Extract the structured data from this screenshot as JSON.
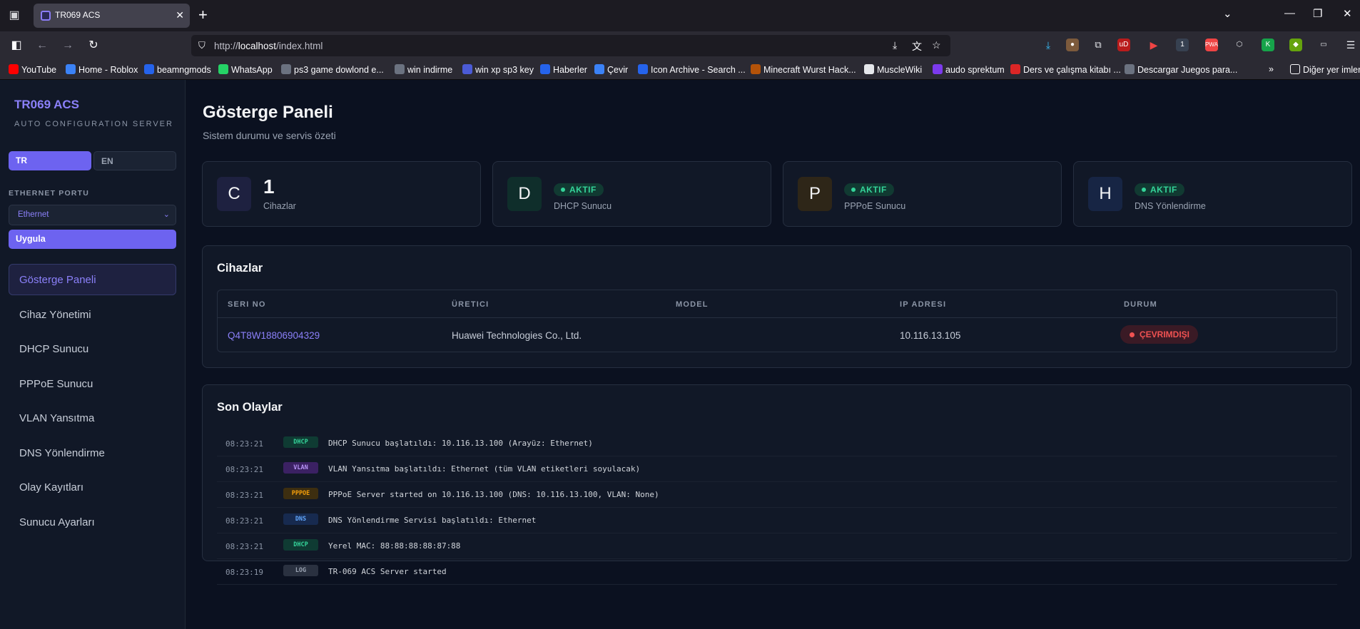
{
  "browser": {
    "tab_title": "TR069 ACS",
    "url_prefix": "http://",
    "url_host": "localhost",
    "url_path": "/index.html",
    "bookmarks": [
      {
        "label": "YouTube",
        "icon": "youtube-icon",
        "color": "#ff0000"
      },
      {
        "label": "Home - Roblox",
        "icon": "roblox-icon",
        "color": "#3b82f6"
      },
      {
        "label": "beamngmods",
        "icon": "beamng-icon",
        "color": "#2563eb"
      },
      {
        "label": "WhatsApp",
        "icon": "whatsapp-icon",
        "color": "#25d366"
      },
      {
        "label": "ps3 game dowlond e...",
        "icon": "globe-icon",
        "color": "#6b7280"
      },
      {
        "label": "win indirme",
        "icon": "globe-icon",
        "color": "#6b7280"
      },
      {
        "label": "win xp sp3 key",
        "icon": "wordpress-icon",
        "color": "#4b5bd6"
      },
      {
        "label": "Haberler",
        "icon": "news-icon",
        "color": "#2563eb"
      },
      {
        "label": "Çevir",
        "icon": "translate-icon",
        "color": "#3b82f6"
      },
      {
        "label": "Icon Archive - Search ...",
        "icon": "star-icon",
        "color": "#2563eb"
      },
      {
        "label": "Minecraft Wurst Hack...",
        "icon": "wurst-icon",
        "color": "#b45309"
      },
      {
        "label": "MuscleWiki",
        "icon": "musclewiki-icon",
        "color": "#e5e7eb"
      },
      {
        "label": "audo sprektum",
        "icon": "audio-icon",
        "color": "#7c3aed"
      },
      {
        "label": "Ders ve çalışma kitabı ...",
        "icon": "book-icon",
        "color": "#dc2626"
      },
      {
        "label": "Descargar Juegos para...",
        "icon": "globe-icon",
        "color": "#6b7280"
      }
    ],
    "other_bookmarks": "Diğer yer imler"
  },
  "sidebar": {
    "brand": "TR069 ACS",
    "brand_sub": "AUTO CONFIGURATION SERVER",
    "lang_tr": "TR",
    "lang_en": "EN",
    "port_label": "ETHERNET PORTU",
    "port_value": "Ethernet",
    "apply": "Uygula",
    "menu": [
      "Gösterge Paneli",
      "Cihaz Yönetimi",
      "DHCP Sunucu",
      "PPPoE Sunucu",
      "VLAN Yansıtma",
      "DNS Yönlendirme",
      "Olay Kayıtları",
      "Sunucu Ayarları"
    ],
    "active_index": 0
  },
  "main": {
    "title": "Gösterge Paneli",
    "subtitle": "Sistem durumu ve servis özeti",
    "stats": [
      {
        "letter": "C",
        "value": "1",
        "label": "Cihazlar",
        "color": "#1e2140"
      },
      {
        "letter": "D",
        "status": "AKTIF",
        "label": "DHCP Sunucu",
        "color": "#0f2e2b"
      },
      {
        "letter": "P",
        "status": "AKTIF",
        "label": "PPPoE Sunucu",
        "color": "#2e2618"
      },
      {
        "letter": "H",
        "status": "AKTIF",
        "label": "DNS Yönlendirme",
        "color": "#172544"
      }
    ],
    "devices": {
      "title": "Cihazlar",
      "columns": [
        "SERI NO",
        "ÜRETICI",
        "MODEL",
        "IP ADRESI",
        "DURUM"
      ],
      "rows": [
        {
          "serial": "Q4T8W18806904329",
          "vendor": "Huawei Technologies Co., Ltd.",
          "model": "",
          "ip": "10.116.13.105",
          "status": "ÇEVRIMDIŞI"
        }
      ]
    },
    "events": {
      "title": "Son Olaylar",
      "items": [
        {
          "time": "08:23:21",
          "tag": "DHCP",
          "tag_bg": "#0f3b33",
          "tag_fg": "#34d399",
          "message": "DHCP Sunucu başlatıldı: 10.116.13.100 (Arayüz: Ethernet)"
        },
        {
          "time": "08:23:21",
          "tag": "VLAN",
          "tag_bg": "#3b2163",
          "tag_fg": "#b794f6",
          "message": "VLAN Yansıtma başlatıldı: Ethernet (tüm VLAN etiketleri soyulacak)"
        },
        {
          "time": "08:23:21",
          "tag": "PPPOE",
          "tag_bg": "#3d2e10",
          "tag_fg": "#f59e0b",
          "message": "PPPoE Server started on 10.116.13.100 (DNS: 10.116.13.100, VLAN: None)"
        },
        {
          "time": "08:23:21",
          "tag": "DNS",
          "tag_bg": "#172a4f",
          "tag_fg": "#60a5fa",
          "message": "DNS Yönlendirme Servisi başlatıldı: Ethernet"
        },
        {
          "time": "08:23:21",
          "tag": "DHCP",
          "tag_bg": "#0f3b33",
          "tag_fg": "#34d399",
          "message": "Yerel MAC: 88:88:88:88:87:88"
        },
        {
          "time": "08:23:19",
          "tag": "LOG",
          "tag_bg": "#2a3140",
          "tag_fg": "#9aa3b2",
          "message": "TR-069 ACS Server started"
        }
      ]
    }
  }
}
